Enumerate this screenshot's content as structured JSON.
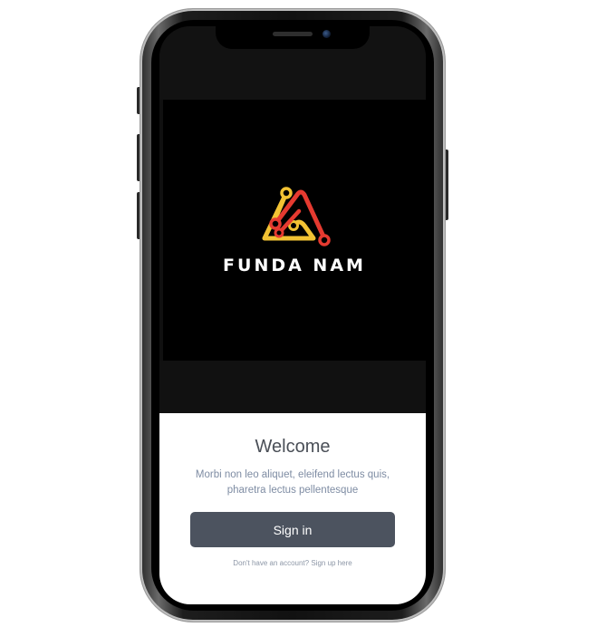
{
  "splash": {
    "brand_name": "FUNDA NAM",
    "logo_icon": "funda-nam-logo-icon",
    "logo_colors": {
      "yellow": "#f2c233",
      "red": "#e53a30"
    }
  },
  "welcome": {
    "title": "Welcome",
    "description": "Morbi non leo aliquet, eleifend lectus quis, pharetra lectus pellentesque",
    "sign_in_label": "Sign in",
    "sign_up_prompt": "Don't have an account? Sign up here"
  },
  "colors": {
    "button_bg": "#4c535f",
    "title_text": "#4a4f57",
    "description_text": "#7e8ca3"
  }
}
